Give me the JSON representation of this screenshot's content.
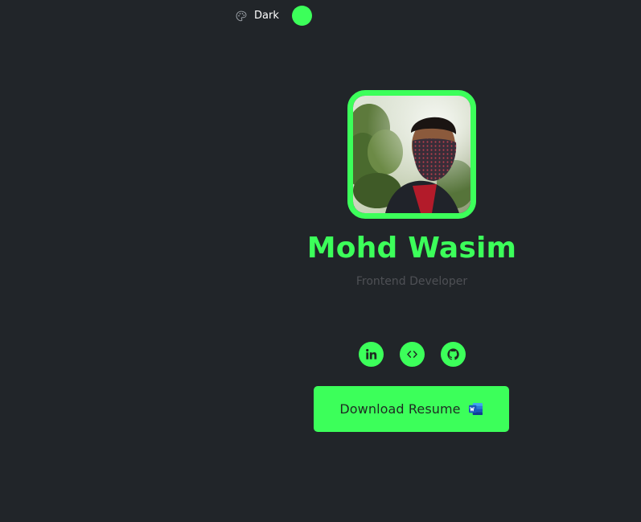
{
  "theme_toggle": {
    "icon": "palette-icon",
    "label": "Dark",
    "accent_color": "#3cff5a"
  },
  "profile": {
    "avatar_alt": "profile-photo",
    "name": "Mohd Wasim",
    "role": "Frontend Developer"
  },
  "socials": [
    {
      "icon": "linkedin-icon"
    },
    {
      "icon": "code-icon"
    },
    {
      "icon": "github-icon"
    }
  ],
  "cta": {
    "label": "Download Resume",
    "icon": "word-document-icon"
  },
  "colors": {
    "background": "#212529",
    "accent": "#3cff5a",
    "muted_text": "#4e5055"
  }
}
